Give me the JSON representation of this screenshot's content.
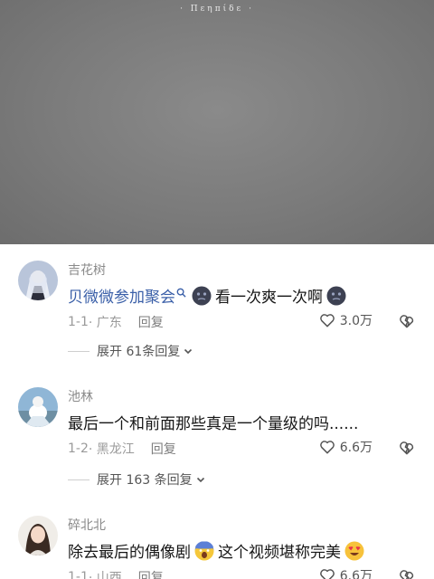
{
  "video": {
    "caption": "· Πεηπίδε ·"
  },
  "comments": [
    {
      "username": "吉花树",
      "content_link": "贝微微参加聚会",
      "content_text": "看一次爽一次啊",
      "meta_date": "1-1",
      "meta_location": "· 广东",
      "reply_label": "回复",
      "like_count": "3.0万",
      "expand_label": "展开 61条回复"
    },
    {
      "username": "池林",
      "content_text": "最后一个和前面那些真是一个量级的吗......",
      "meta_date": "1-2",
      "meta_location": "· 黑龙江",
      "reply_label": "回复",
      "like_count": "6.6万",
      "expand_label": "展开 163 条回复"
    },
    {
      "username": "碎北北",
      "content_text_1": "除去最后的偶像剧",
      "content_text_2": "这个视频堪称完美",
      "meta_date": "1-1",
      "meta_location": "· 山西",
      "reply_label": "回复",
      "like_count": "6.6万"
    }
  ],
  "colors": {
    "link": "#3a5fa8",
    "meta": "#9a9a9a",
    "text": "#161616"
  }
}
